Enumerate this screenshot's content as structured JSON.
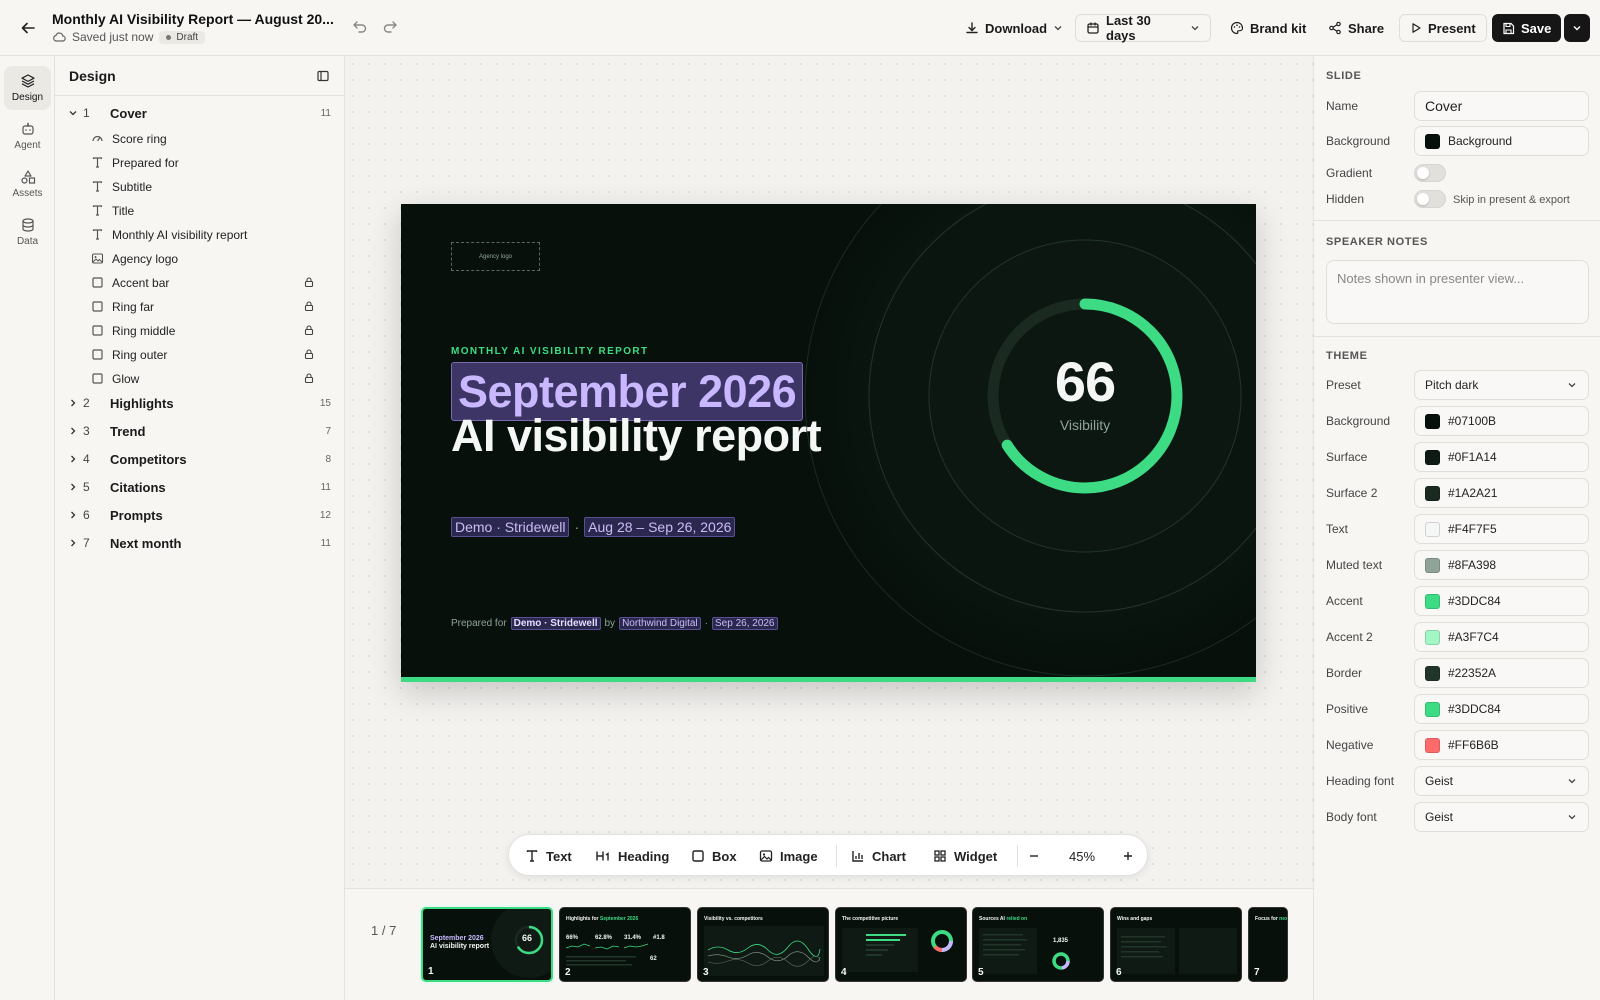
{
  "header": {
    "title": "Monthly AI Visibility Report — August 20...",
    "save_status": "Saved just now",
    "badge": "Draft",
    "download": "Download",
    "date_range": "Last 30 days",
    "brand_kit": "Brand kit",
    "share": "Share",
    "present": "Present",
    "save": "Save"
  },
  "rail": [
    {
      "label": "Design",
      "icon": "layers-icon"
    },
    {
      "label": "Agent",
      "icon": "robot-icon"
    },
    {
      "label": "Assets",
      "icon": "shapes-icon"
    },
    {
      "label": "Data",
      "icon": "database-icon"
    }
  ],
  "layers": {
    "title": "Design",
    "cover": {
      "num": "1",
      "name": "Cover",
      "count": "11"
    },
    "cover_children": [
      {
        "name": "Score ring",
        "icon": "gauge-icon",
        "locked": false
      },
      {
        "name": "Prepared for",
        "icon": "text-icon",
        "locked": false
      },
      {
        "name": "Subtitle",
        "icon": "text-icon",
        "locked": false
      },
      {
        "name": "Title",
        "icon": "text-icon",
        "locked": false
      },
      {
        "name": "Monthly AI visibility report",
        "icon": "text-icon",
        "locked": false
      },
      {
        "name": "Agency logo",
        "icon": "image-icon",
        "locked": false
      },
      {
        "name": "Accent bar",
        "icon": "box-icon",
        "locked": true
      },
      {
        "name": "Ring far",
        "icon": "box-icon",
        "locked": true
      },
      {
        "name": "Ring middle",
        "icon": "box-icon",
        "locked": true
      },
      {
        "name": "Ring outer",
        "icon": "box-icon",
        "locked": true
      },
      {
        "name": "Glow",
        "icon": "box-icon",
        "locked": true
      }
    ],
    "sections": [
      {
        "num": "2",
        "name": "Highlights",
        "count": "15"
      },
      {
        "num": "3",
        "name": "Trend",
        "count": "7"
      },
      {
        "num": "4",
        "name": "Competitors",
        "count": "8"
      },
      {
        "num": "5",
        "name": "Citations",
        "count": "11"
      },
      {
        "num": "6",
        "name": "Prompts",
        "count": "12"
      },
      {
        "num": "7",
        "name": "Next month",
        "count": "11"
      }
    ]
  },
  "slide": {
    "agency_logo": "Agency logo",
    "kicker": "MONTHLY AI VISIBILITY REPORT",
    "title_line1": "September 2026",
    "title_line2": "AI visibility report",
    "client": "Demo · Stridewell",
    "sep": "·",
    "range": "Aug 28 – Sep 26, 2026",
    "prepared_for": "Prepared for",
    "prepared_client": "Demo · Stridewell",
    "by": "by",
    "agency": "Northwind Digital",
    "date": "Sep 26, 2026",
    "score": "66",
    "score_label": "Visibility",
    "score_fraction": 0.66
  },
  "toolbar": {
    "text": "Text",
    "heading": "Heading",
    "box": "Box",
    "image": "Image",
    "chart": "Chart",
    "widget": "Widget",
    "zoom": "45%"
  },
  "filmstrip": {
    "pager": "1 / 7",
    "thumbs": [
      {
        "n": "1"
      },
      {
        "n": "2",
        "title": "Highlights for",
        "accent": "September 2026"
      },
      {
        "n": "3",
        "title": "Visibility vs. competitors",
        "accent": ""
      },
      {
        "n": "4",
        "title": "The competitive picture",
        "accent": ""
      },
      {
        "n": "5",
        "title": "Sources AI",
        "accent": "relied on"
      },
      {
        "n": "6",
        "title": "Wins and gaps",
        "accent": ""
      },
      {
        "n": "7",
        "title": "Focus for",
        "accent": "next"
      }
    ],
    "thumb1": {
      "line1": "September 2026",
      "line2": "AI visibility report",
      "score": "66"
    },
    "thumb2": {
      "stat1": "66%",
      "stat2": "62.8%",
      "stat3": "31.4%",
      "stat4": "#1.8",
      "stat5": "62"
    },
    "thumb5": {
      "stat": "1,835"
    }
  },
  "inspector": {
    "slide_section": "SLIDE",
    "name_label": "Name",
    "name_value": "Cover",
    "background_label": "Background",
    "background_value": "Background",
    "gradient_label": "Gradient",
    "hidden_label": "Hidden",
    "hidden_hint": "Skip in present & export",
    "notes_section": "SPEAKER NOTES",
    "notes_placeholder": "Notes shown in presenter view...",
    "theme_section": "THEME",
    "preset_label": "Preset",
    "preset_value": "Pitch dark",
    "colors": [
      {
        "label": "Background",
        "value": "#07100B"
      },
      {
        "label": "Surface",
        "value": "#0F1A14"
      },
      {
        "label": "Surface 2",
        "value": "#1A2A21"
      },
      {
        "label": "Text",
        "value": "#F4F7F5"
      },
      {
        "label": "Muted text",
        "value": "#8FA398"
      },
      {
        "label": "Accent",
        "value": "#3DDC84"
      },
      {
        "label": "Accent 2",
        "value": "#A3F7C4"
      },
      {
        "label": "Border",
        "value": "#22352A"
      },
      {
        "label": "Positive",
        "value": "#3DDC84"
      },
      {
        "label": "Negative",
        "value": "#FF6B6B"
      }
    ],
    "heading_font_label": "Heading font",
    "heading_font_value": "Geist",
    "body_font_label": "Body font",
    "body_font_value": "Geist"
  }
}
